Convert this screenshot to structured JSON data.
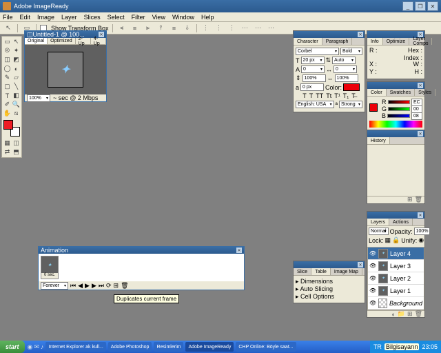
{
  "app": {
    "title": "Adobe ImageReady"
  },
  "menu": [
    "File",
    "Edit",
    "Image",
    "Layer",
    "Slices",
    "Select",
    "Filter",
    "View",
    "Window",
    "Help"
  ],
  "toolbar": {
    "transform_label": "Show Transform Box"
  },
  "doc": {
    "title": "Untitled-1 @ 100...",
    "tabs": [
      "Original",
      "Optimized",
      "2-Up",
      "4-Up"
    ],
    "zoom": "100%",
    "status": "~ sec @ 2 Mbps"
  },
  "character": {
    "tabs": [
      "Character",
      "Paragraph"
    ],
    "font": "Corbel",
    "weight": "Bold",
    "size": "20 px",
    "leading": "Auto",
    "kern": "0",
    "track": "0",
    "vscale": "100%",
    "hscale": "100%",
    "baseline": "0 px",
    "color_label": "Color:",
    "lang": "English: USA",
    "aa": "Strong"
  },
  "info": {
    "tabs": [
      "Info",
      "Optimize",
      "Layer Comps"
    ],
    "r": "R :",
    "hex": "Hex :",
    "index": "Index :",
    "x": "X :",
    "y": "Y :",
    "w": "W :",
    "h": "H :"
  },
  "color": {
    "tabs": [
      "Color",
      "Swatches",
      "Styles"
    ],
    "r": "EC",
    "g": "00",
    "b": "08"
  },
  "history": {
    "tab": "History"
  },
  "layers": {
    "tabs": [
      "Layers",
      "Actions"
    ],
    "mode": "Normal",
    "opacity_label": "Opacity:",
    "opacity": "100%",
    "lock": "Lock:",
    "unify": "Unify:",
    "items": [
      {
        "name": "Layer 4",
        "active": true
      },
      {
        "name": "Layer 3"
      },
      {
        "name": "Layer 2"
      },
      {
        "name": "Layer 1"
      },
      {
        "name": "Background",
        "italic": true
      }
    ]
  },
  "table": {
    "tabs": [
      "Slice",
      "Table",
      "Image Map"
    ],
    "items": [
      "Dimensions",
      "Auto Slicing",
      "Cell Options"
    ]
  },
  "animation": {
    "tab": "Animation",
    "frame_time": "0 sec.",
    "loop": "Forever",
    "tooltip": "Duplicates current frame"
  },
  "taskbar": {
    "start": "start",
    "tasks": [
      "Internet Explorer ak kull...",
      "Adobe Photoshop",
      "Resimlerim",
      "Adobe ImageReady",
      "CHP Online: Böyle saat..."
    ],
    "tray": {
      "lang": "TR",
      "balloon": "Bilgisayarın",
      "time": "23:05"
    }
  }
}
